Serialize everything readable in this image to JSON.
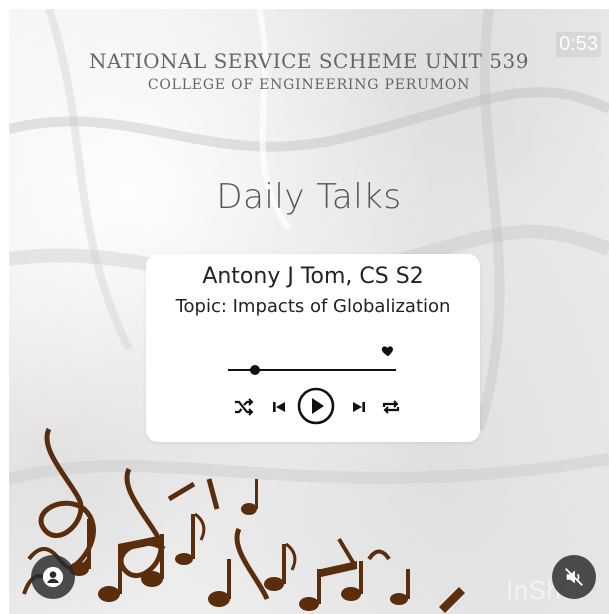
{
  "header": {
    "org_line1": "NATIONAL SERVICE SCHEME UNIT 539",
    "org_line2": "COLLEGE OF ENGINEERING PERUMON"
  },
  "video": {
    "timer": "0:53",
    "watermark": "InShot"
  },
  "main": {
    "title": "Daily Talks"
  },
  "card": {
    "speaker": "Antony J Tom, CS S2",
    "topic": "Topic: Impacts of Globalization",
    "progress": 0.16,
    "controls": [
      "shuffle-icon",
      "previous-icon",
      "play-icon",
      "next-icon",
      "repeat-icon"
    ]
  },
  "overlay": {
    "left_button_icon": "profile-icon",
    "right_button_icon": "mute-icon"
  },
  "colors": {
    "notes": "#5a2d0c",
    "card": "#ffffff",
    "text": "#222222"
  }
}
